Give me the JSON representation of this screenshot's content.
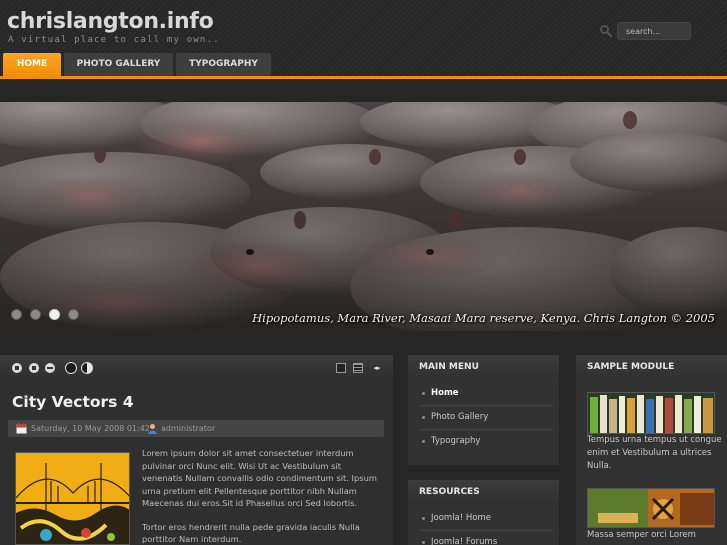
{
  "site": {
    "title": "chrislangton.info",
    "tagline": "A virtual place to call my own..",
    "search_placeholder": "search..."
  },
  "nav": {
    "tabs": [
      {
        "label": "HOME",
        "active": true
      },
      {
        "label": "PHOTO GALLERY",
        "active": false
      },
      {
        "label": "TYPOGRAPHY",
        "active": false
      }
    ],
    "accent_color": "#f28e06"
  },
  "slideshow": {
    "caption": "Hipopotamus, Mara River, Masaai Mara reserve, Kenya. Chris Langton © 2005",
    "slide_count": 4,
    "active_slide": 3
  },
  "article": {
    "title": "City Vectors 4",
    "date": "Saturday, 10 May 2008 01:42",
    "author": "administrator",
    "paragraphs": [
      "Lorem ipsum dolor sit amet consectetuer interdum pulvinar orci Nunc elit. Wisi Ut ac Vestibulum sit venenatis Nullam convallis odio condimentum sit. Ipsum urna pretium elit Pellentesque porttitor nibh Nullam Maecenas dui eros.Sit id Phasellus orci Sed lobortis.",
      "Tortor eros hendrerit nulla pede gravida iaculis Nulla porttitor Nam interdum."
    ]
  },
  "main_menu": {
    "title": "MAIN MENU",
    "items": [
      {
        "label": "Home",
        "current": true
      },
      {
        "label": "Photo Gallery",
        "current": false
      },
      {
        "label": "Typography",
        "current": false
      }
    ]
  },
  "resources": {
    "title": "RESOURCES",
    "items": [
      {
        "label": "Joomla! Home"
      },
      {
        "label": "Joomla! Forums"
      }
    ]
  },
  "sample_module": {
    "title": "SAMPLE MODULE",
    "text1": "Tempus urna tempus ut congue enim et Vestibulum a ultrices Nulla.",
    "text2": "Massa semper orci Lorem"
  }
}
